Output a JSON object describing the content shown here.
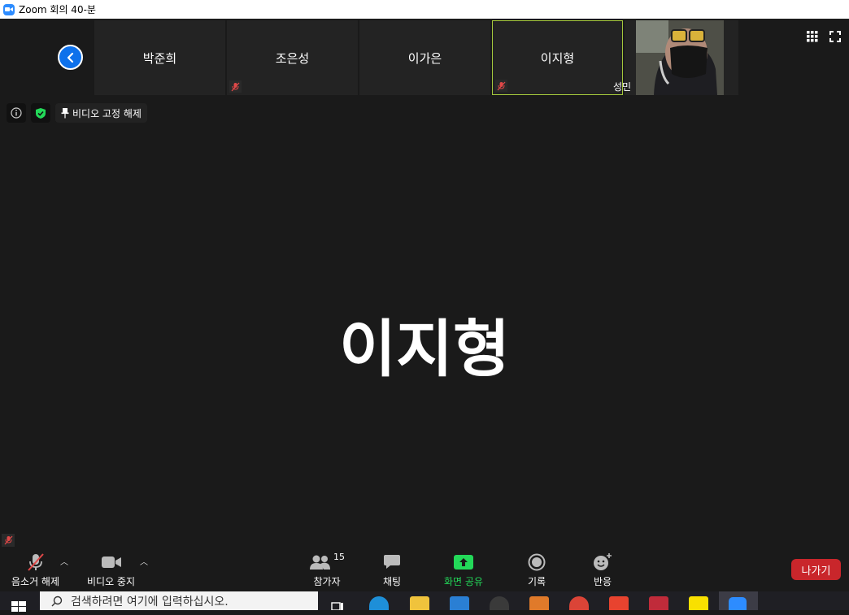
{
  "window": {
    "title": "Zoom 회의 40-분"
  },
  "thumbnails": [
    {
      "name": "박준희",
      "muted": false,
      "active": false
    },
    {
      "name": "조은성",
      "muted": true,
      "active": false
    },
    {
      "name": "이가은",
      "muted": false,
      "active": false
    },
    {
      "name": "이지형",
      "muted": true,
      "active": true
    }
  ],
  "video_tile": {
    "name": "성민"
  },
  "info_bar": {
    "unpin_label": "비디오 고정 해제"
  },
  "main": {
    "speaker_name": "이지형"
  },
  "toolbar": {
    "unmute_label": "음소거 해제",
    "stop_video_label": "비디오 중지",
    "participants_label": "참가자",
    "participants_count": "15",
    "chat_label": "채팅",
    "share_label": "화면 공유",
    "record_label": "기록",
    "reactions_label": "반응",
    "leave_label": "나가기",
    "share_color": "#23d959"
  },
  "taskbar": {
    "search_placeholder": "검색하려면 여기에 입력하십시오."
  }
}
